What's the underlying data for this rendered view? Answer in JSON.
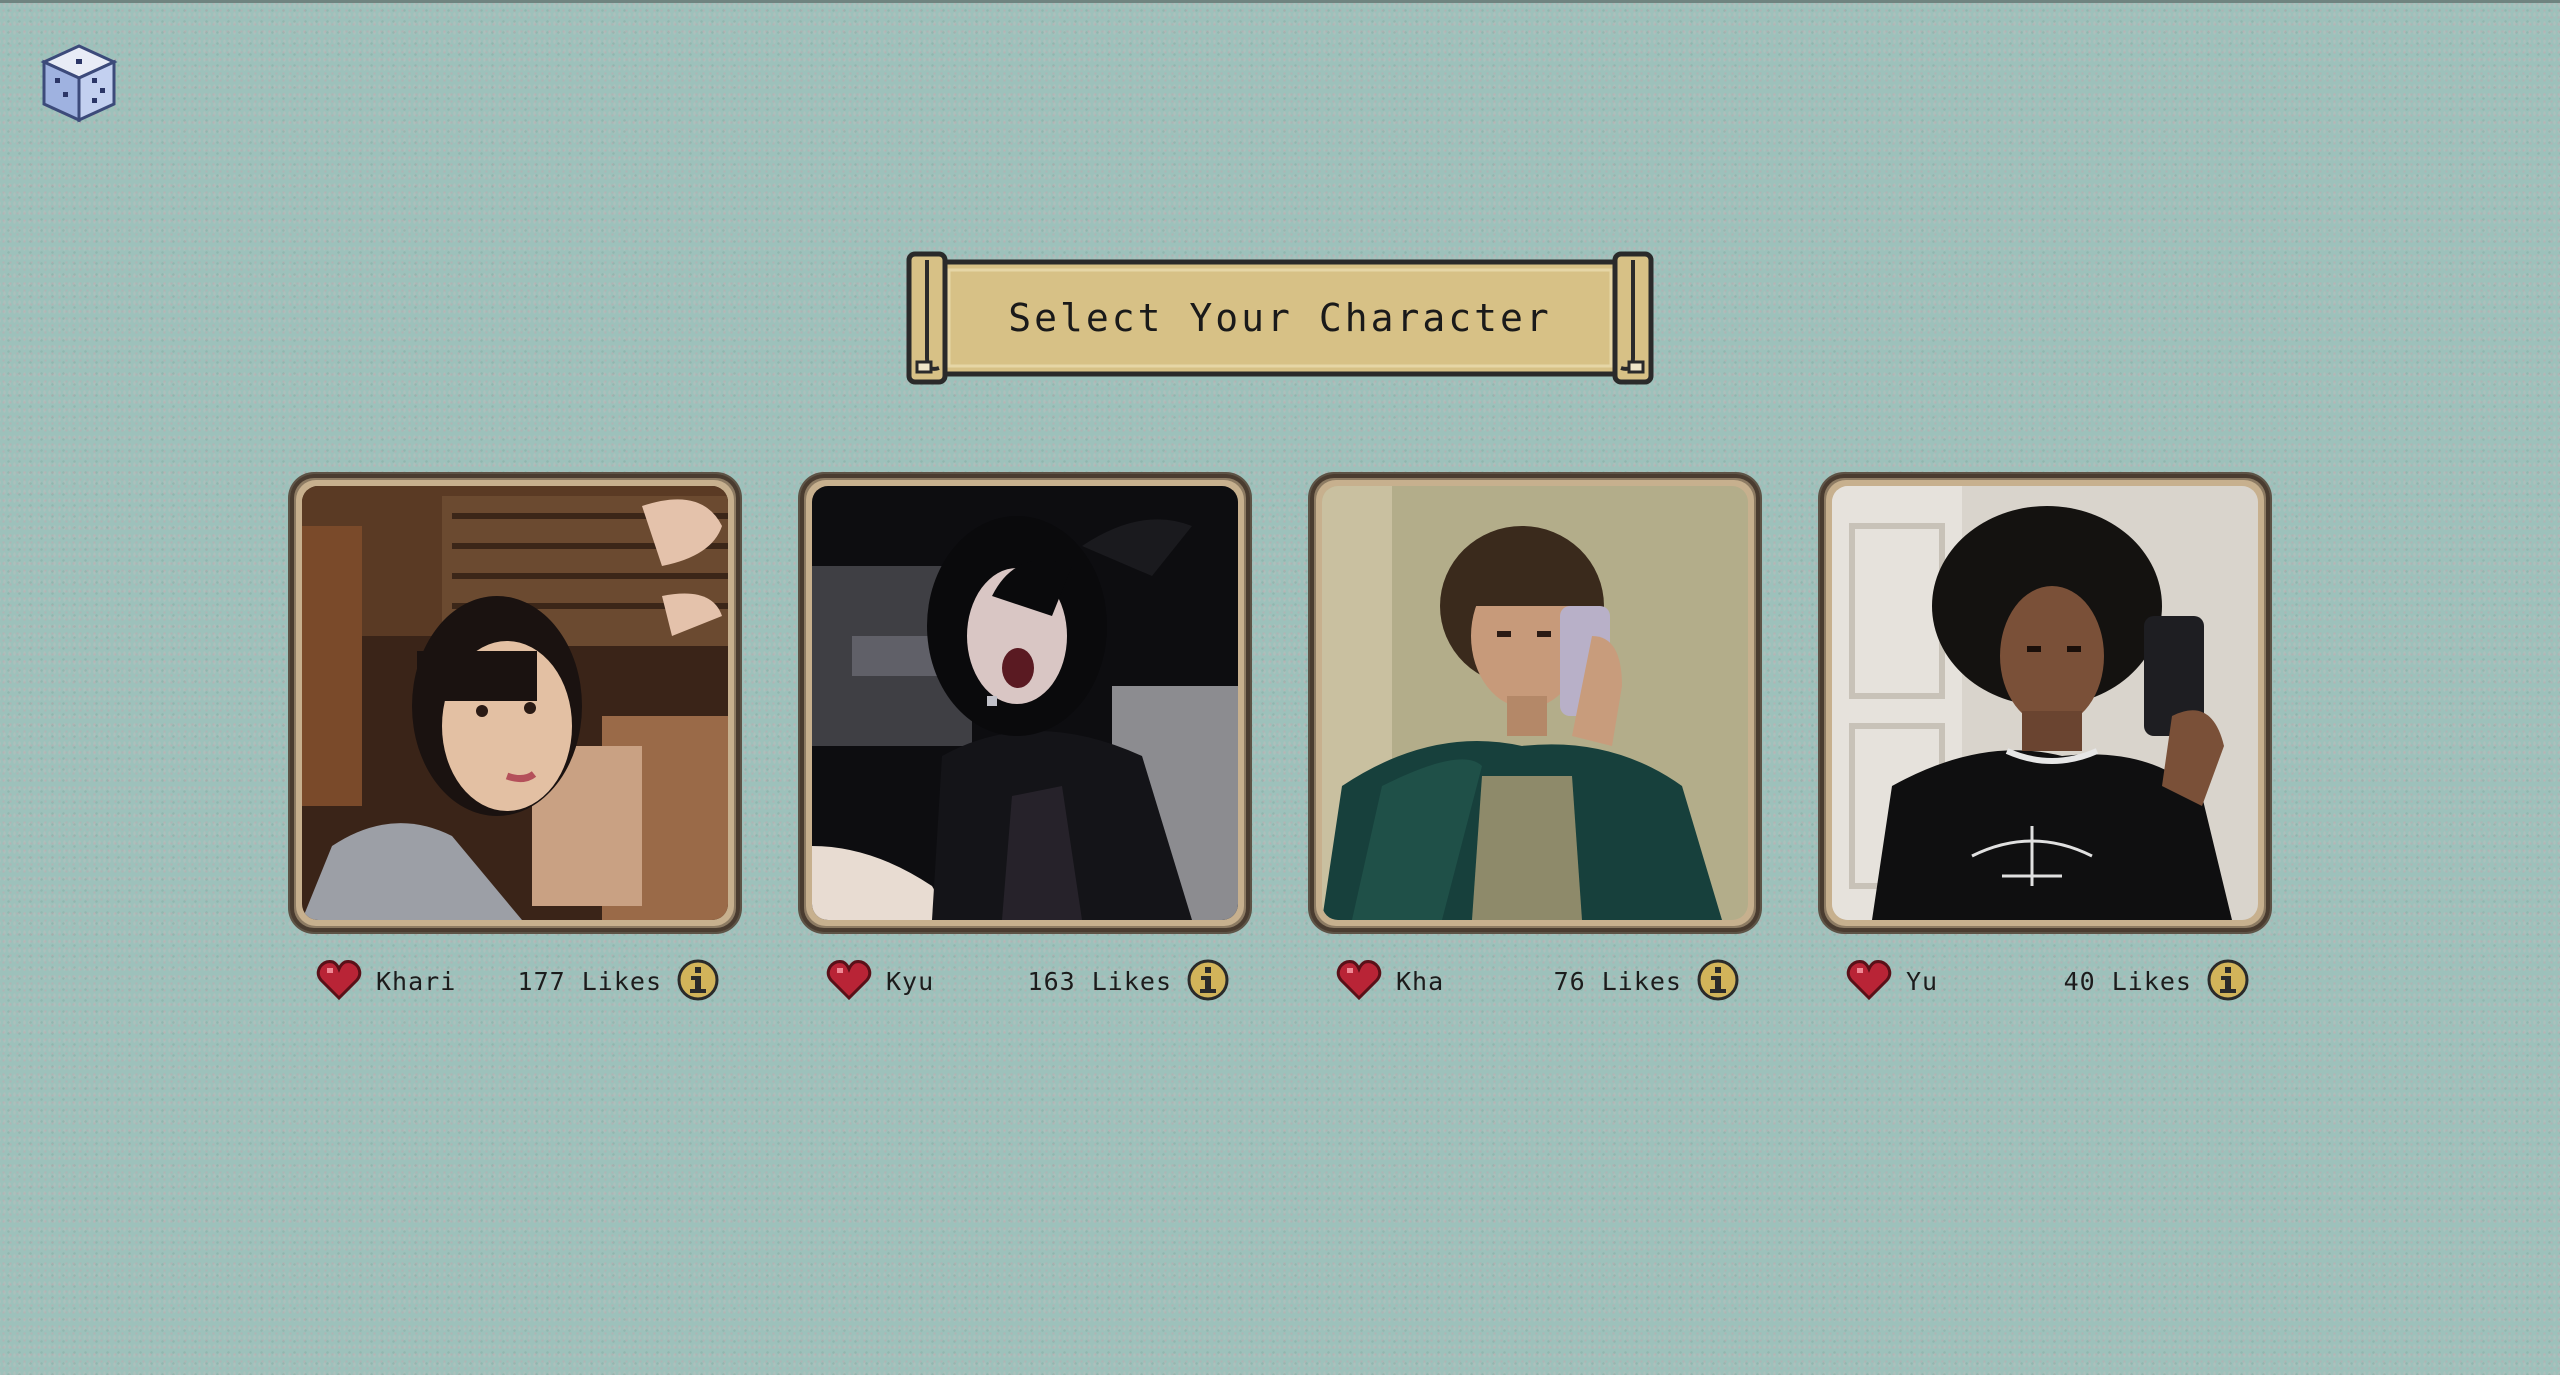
{
  "page": {
    "title": "Select Your Character"
  },
  "colors": {
    "background": "#9dc1bb",
    "banner": "#d7c186",
    "heart": "#b92436",
    "info": "#d2b45a",
    "frame": "#8d7b63"
  },
  "icons": {
    "dice": "dice-icon",
    "like": "heart-icon",
    "info": "info-icon"
  },
  "characters": [
    {
      "name": "Khari",
      "likes": "177 Likes"
    },
    {
      "name": "Kyu",
      "likes": "163 Likes"
    },
    {
      "name": "Kha",
      "likes": "76 Likes"
    },
    {
      "name": "Yu",
      "likes": "40 Likes"
    }
  ]
}
